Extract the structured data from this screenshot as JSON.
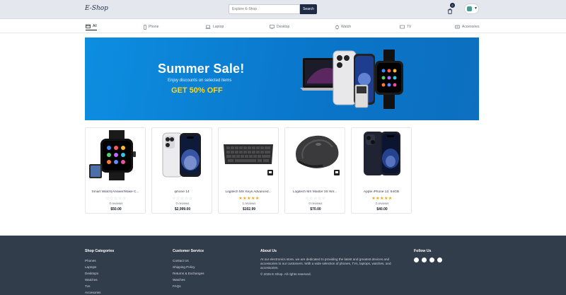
{
  "header": {
    "logo": "E-Shop",
    "search_placeholder": "Explore E-Shop",
    "search_button": "Search",
    "cart_count": "2"
  },
  "categories": [
    {
      "label": "All",
      "icon": "store-icon",
      "active": true
    },
    {
      "label": "Phone",
      "icon": "phone-icon"
    },
    {
      "label": "Laptop",
      "icon": "laptop-icon"
    },
    {
      "label": "Desktop",
      "icon": "desktop-icon"
    },
    {
      "label": "Watch",
      "icon": "watch-icon"
    },
    {
      "label": "TV",
      "icon": "tv-icon"
    },
    {
      "label": "Accesories",
      "icon": "accessories-icon"
    }
  ],
  "banner": {
    "title": "Summer Sale!",
    "subtitle": "Enjoy discounts on selected items",
    "offer": "GET 50% OFF"
  },
  "products": [
    {
      "name": "Smart Watch(Answer/Make C...",
      "rating": 0,
      "reviews": "0 reviews",
      "price": "$50.00"
    },
    {
      "name": "iphone 14",
      "rating": 0,
      "reviews": "0 reviews",
      "price": "$2,999.00"
    },
    {
      "name": "Logitech MX Keys Advanced...",
      "rating": 5,
      "reviews": "1 reviews",
      "price": "$102.99"
    },
    {
      "name": "Logitech MX Master 3S Wir...",
      "rating": 0,
      "reviews": "0 reviews",
      "price": "$70.00"
    },
    {
      "name": "Apple iPhone 12, 64GB",
      "rating": 5,
      "reviews": "2 reviews",
      "price": "$40.00"
    }
  ],
  "footer": {
    "shop_categories": {
      "title": "Shop Categories",
      "links": [
        "Phones",
        "Laptops",
        "Desktops",
        "Watches",
        "Tvs",
        "Accesories"
      ]
    },
    "customer_service": {
      "title": "Customer Service",
      "links": [
        "Contact Us",
        "Shipping Policy",
        "Returns & Exchanges",
        "Watches",
        "FAQs"
      ]
    },
    "about": {
      "title": "About Us",
      "text": "At our electronics store, we are dedicated to providing the latest and greatest devices and accessories to our customers. With a wide selection of phones, TVs, laptops, watches, and accessories.",
      "copyright": "© 2025 E-Shop. All rights reserved."
    },
    "follow": {
      "title": "Follow Us",
      "icons": [
        "facebook-icon",
        "twitter-icon",
        "instagram-icon",
        "youtube-icon"
      ]
    }
  },
  "colors": {
    "header_bg": "#e5e7ef",
    "brand_dark": "#1f2a44",
    "banner_blue": "#0a75c9",
    "offer_yellow": "#ffd51c",
    "star": "#f59e0b",
    "footer_bg": "#323d4c"
  }
}
